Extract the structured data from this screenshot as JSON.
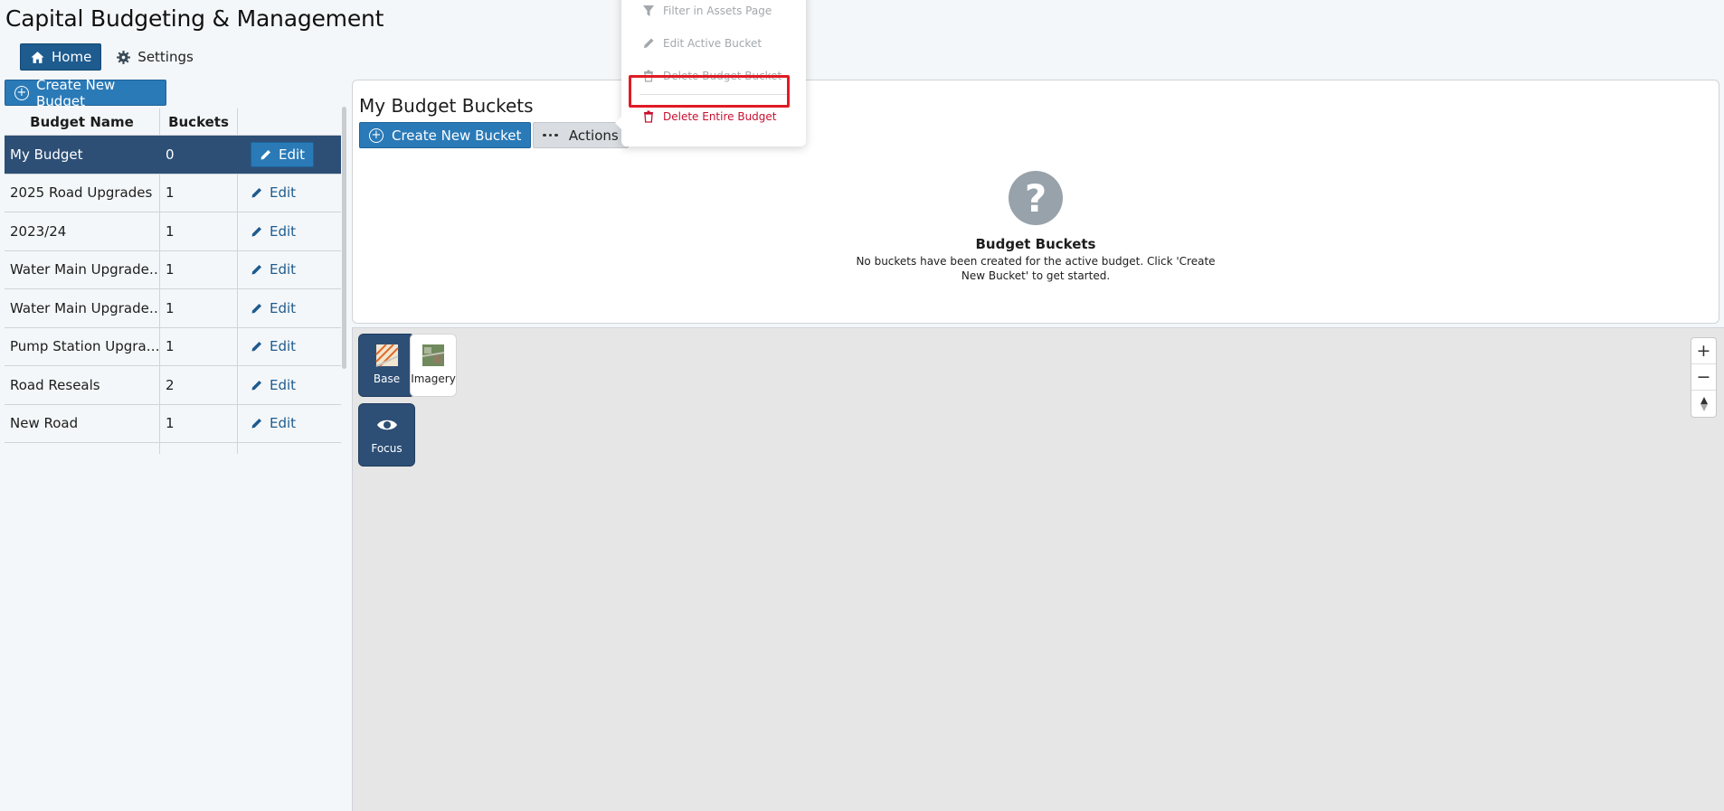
{
  "app": {
    "title": "Capital Budgeting & Management"
  },
  "nav": {
    "home": "Home",
    "settings": "Settings"
  },
  "sidebar": {
    "create_budget_label": "Create New Budget",
    "columns": {
      "name": "Budget Name",
      "buckets": "Buckets"
    },
    "rows": [
      {
        "name": "My Budget",
        "buckets": "0",
        "edit": "Edit"
      },
      {
        "name": "2025 Road Upgrades",
        "buckets": "1",
        "edit": "Edit"
      },
      {
        "name": "2023/24",
        "buckets": "1",
        "edit": "Edit"
      },
      {
        "name": "Water Main Upgrade…",
        "buckets": "1",
        "edit": "Edit"
      },
      {
        "name": "Water Main Upgrade…",
        "buckets": "1",
        "edit": "Edit"
      },
      {
        "name": "Pump Station Upgra…",
        "buckets": "1",
        "edit": "Edit"
      },
      {
        "name": "Road Reseals",
        "buckets": "2",
        "edit": "Edit"
      },
      {
        "name": "New Road",
        "buckets": "1",
        "edit": "Edit"
      }
    ]
  },
  "buckets_panel": {
    "title": "My Budget Buckets",
    "create_bucket_label": "Create New Bucket",
    "actions_label": "Actions",
    "empty_title": "Budget Buckets",
    "empty_message": "No buckets have been created for the active budget. Click 'Create New Bucket' to get started."
  },
  "actions_menu": {
    "items": [
      {
        "label": "Filter in Assets Page",
        "icon": "filter-icon"
      },
      {
        "label": "Edit Active Bucket",
        "icon": "pencil-icon"
      },
      {
        "label": "Delete Budget Bucket",
        "icon": "trash-icon"
      }
    ],
    "danger_item": {
      "label": "Delete Entire Budget",
      "icon": "trash-icon"
    }
  },
  "map": {
    "tiles": {
      "base": "Base",
      "imagery": "Imagery",
      "focus": "Focus"
    },
    "controls": {
      "zoom_in": "+",
      "zoom_out": "−"
    }
  },
  "colors": {
    "primary": "#2a7ab8",
    "selected_row": "#2d4f76",
    "danger": "#c8102e",
    "highlight": "#e01b24"
  }
}
